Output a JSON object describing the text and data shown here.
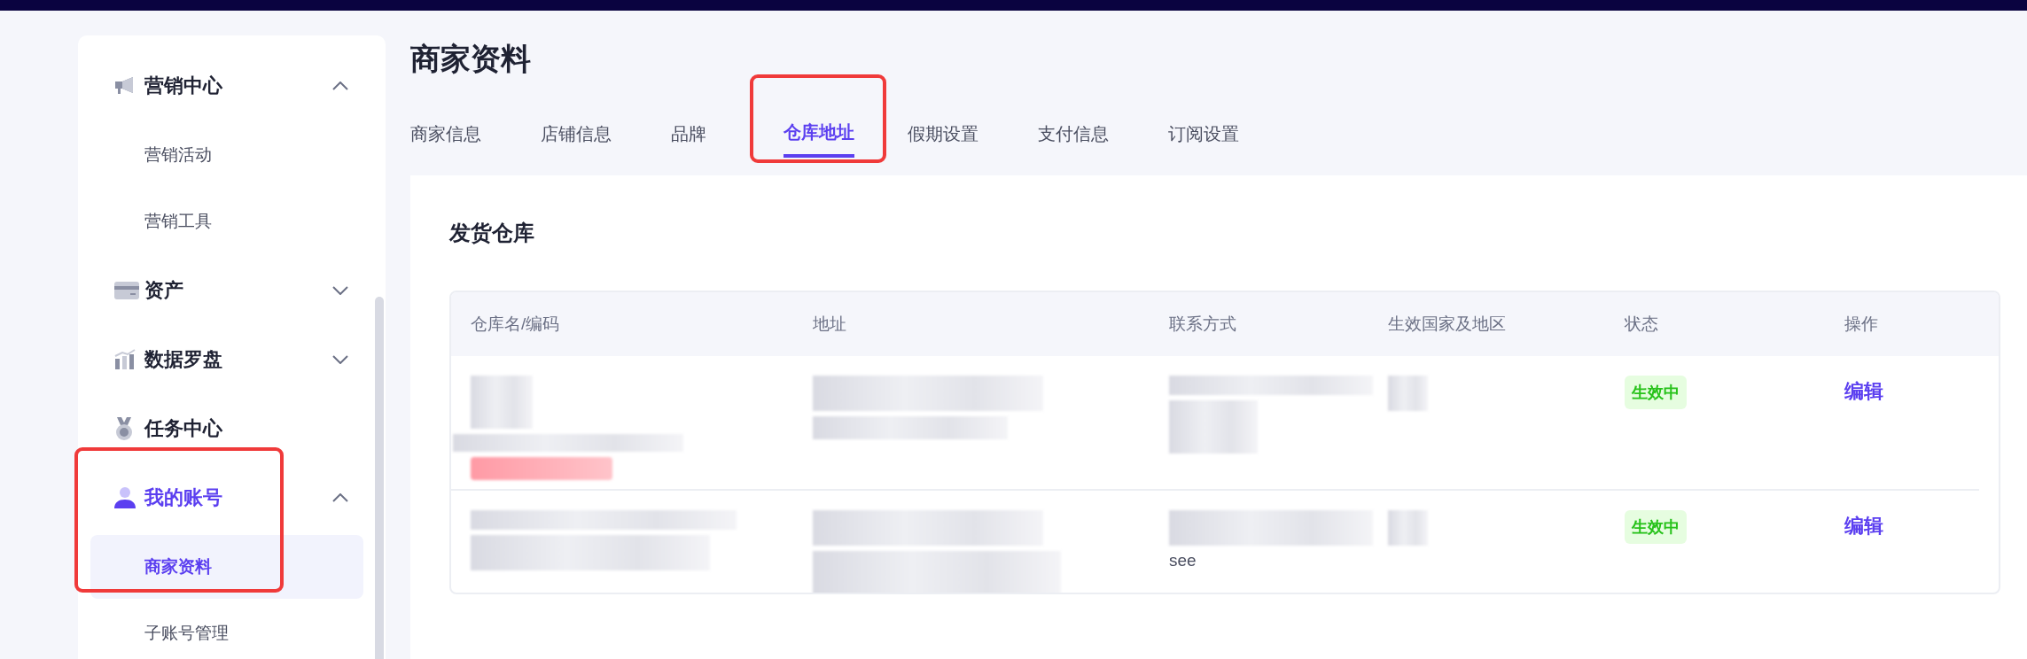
{
  "sidebar": {
    "items": [
      {
        "label": "营销中心",
        "kind": "group",
        "expanded": true,
        "selected": false,
        "highlighted": false,
        "children": [
          {
            "label": "营销活动",
            "selected": false
          },
          {
            "label": "营销工具",
            "selected": false
          }
        ]
      },
      {
        "label": "资产",
        "kind": "group",
        "expanded": false,
        "selected": false,
        "highlighted": false
      },
      {
        "label": "数据罗盘",
        "kind": "group",
        "expanded": false,
        "selected": false,
        "highlighted": false
      },
      {
        "label": "任务中心",
        "kind": "link",
        "selected": false,
        "highlighted": false
      },
      {
        "label": "我的账号",
        "kind": "group",
        "expanded": true,
        "selected": true,
        "highlighted": true,
        "children": [
          {
            "label": "商家资料",
            "selected": true
          },
          {
            "label": "子账号管理",
            "selected": false
          }
        ]
      }
    ]
  },
  "page": {
    "title": "商家资料"
  },
  "tabs": [
    {
      "label": "商家信息",
      "selected": false,
      "highlighted": false
    },
    {
      "label": "店铺信息",
      "selected": false,
      "highlighted": false
    },
    {
      "label": "品牌",
      "selected": false,
      "highlighted": false
    },
    {
      "label": "仓库地址",
      "selected": true,
      "highlighted": true
    },
    {
      "label": "假期设置",
      "selected": false,
      "highlighted": false
    },
    {
      "label": "支付信息",
      "selected": false,
      "highlighted": false
    },
    {
      "label": "订阅设置",
      "selected": false,
      "highlighted": false
    }
  ],
  "section": {
    "title": "发货仓库"
  },
  "table": {
    "columns": [
      "仓库名/编码",
      "地址",
      "联系方式",
      "生效国家及地区",
      "状态",
      "操作"
    ],
    "rows": [
      {
        "warehouse": {
          "redacted": true,
          "tag": true
        },
        "address": {
          "redacted": true
        },
        "contact": {
          "redacted": true
        },
        "region": {
          "redacted": true
        },
        "status": "生效中",
        "action": "编辑"
      },
      {
        "warehouse": {
          "redacted": true,
          "tag": false
        },
        "address": {
          "redacted": true
        },
        "contact": {
          "redacted": true,
          "text": "see"
        },
        "region": {
          "redacted": true
        },
        "status": "生效中",
        "action": "编辑"
      }
    ]
  }
}
